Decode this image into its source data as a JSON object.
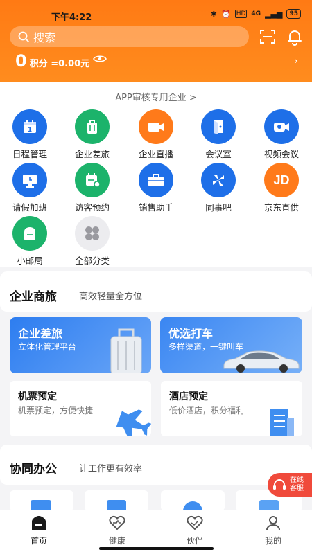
{
  "status_bar": {
    "time": "下午4:22",
    "network": "4G",
    "battery": "95"
  },
  "header": {
    "search_placeholder": "搜索",
    "points_value": "0",
    "points_label": "积分 =0.00元"
  },
  "enterprise_label": "APP审核专用企业 >",
  "grid": [
    {
      "label": "日程管理",
      "icon": "calendar-icon",
      "color": "#1e6fe8"
    },
    {
      "label": "企业差旅",
      "icon": "suitcase-icon",
      "color": "#1cb36b"
    },
    {
      "label": "企业直播",
      "icon": "live-video-icon",
      "color": "#ff7a1a"
    },
    {
      "label": "会议室",
      "icon": "meeting-room-icon",
      "color": "#1e6fe8"
    },
    {
      "label": "视频会议",
      "icon": "video-camera-icon",
      "color": "#1e6fe8"
    },
    {
      "label": "请假加班",
      "icon": "monitor-clock-icon",
      "color": "#1e6fe8"
    },
    {
      "label": "访客预约",
      "icon": "visitor-calendar-icon",
      "color": "#1cb36b"
    },
    {
      "label": "销售助手",
      "icon": "briefcase-icon",
      "color": "#1e6fe8"
    },
    {
      "label": "同事吧",
      "icon": "pinwheel-icon",
      "color": "#1e6fe8"
    },
    {
      "label": "京东直供",
      "icon": "jd-icon",
      "color": "#ff7a1a"
    },
    {
      "label": "小邮局",
      "icon": "mailbox-icon",
      "color": "#1cb36b"
    },
    {
      "label": "全部分类",
      "icon": "all-categories-icon",
      "color": "#e9e9ec"
    }
  ],
  "travel_section": {
    "title": "企业商旅",
    "subtitle": "高效轻量全方位",
    "promo_left": {
      "title": "企业差旅",
      "subtitle": "立体化管理平台"
    },
    "promo_right": {
      "title": "优选打车",
      "subtitle": "多样渠道，一键叫车"
    },
    "tile_left": {
      "title": "机票预定",
      "subtitle": "机票预定，方便快捷"
    },
    "tile_right": {
      "title": "酒店预定",
      "subtitle": "低价酒店，积分福利"
    }
  },
  "office_section": {
    "title": "协同办公",
    "subtitle": "让工作更有效率"
  },
  "online_service": {
    "line1": "在线",
    "line2": "客服"
  },
  "tabs": [
    {
      "label": "首页",
      "icon": "home-icon",
      "active": true
    },
    {
      "label": "健康",
      "icon": "health-heart-icon",
      "active": false
    },
    {
      "label": "伙伴",
      "icon": "partner-heart-icon",
      "active": false
    },
    {
      "label": "我的",
      "icon": "profile-icon",
      "active": false
    }
  ],
  "colors": {
    "header": "#ff7a14",
    "blue": "#1e6fe8",
    "green": "#1cb36b",
    "orange": "#ff7a1a"
  }
}
